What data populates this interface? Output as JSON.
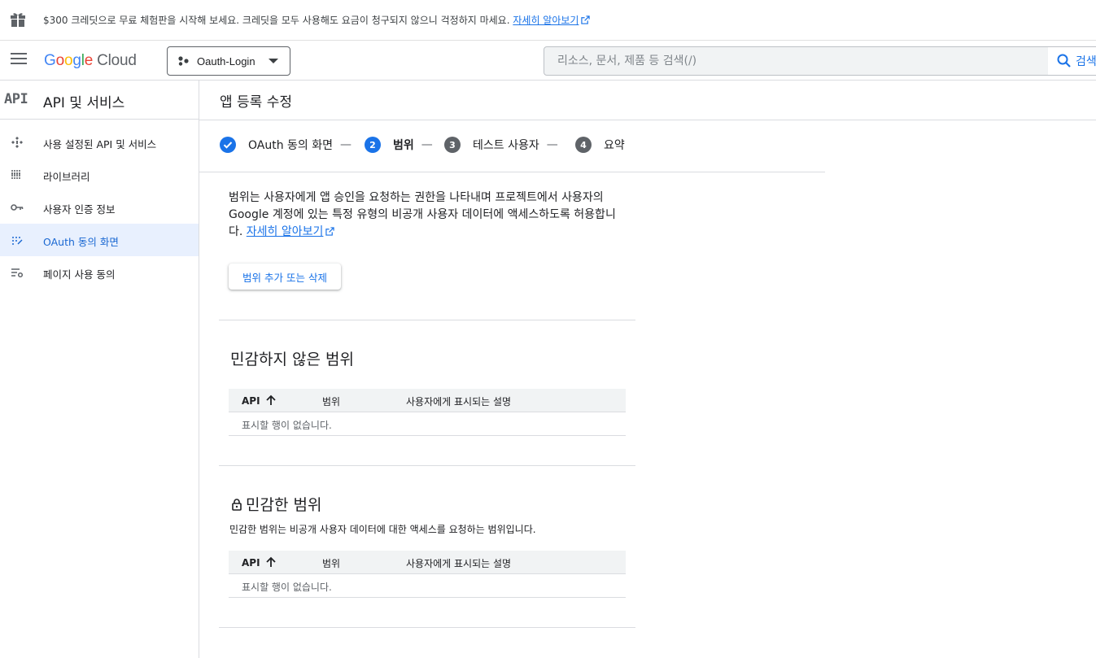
{
  "promo": {
    "text": "$300 크레딧으로 무료 체험판을 시작해 보세요. 크레딧을 모두 사용해도 요금이 청구되지 않으니 걱정하지 마세요.",
    "link": "자세히 알아보기"
  },
  "header": {
    "logo_letters": [
      "G",
      "o",
      "o",
      "g",
      "l",
      "e"
    ],
    "logo_cloud": "Cloud",
    "project_name": "Oauth-Login",
    "search_placeholder": "리소스, 문서, 제품 등 검색(/)",
    "search_button": "검색"
  },
  "sidebar": {
    "logo": "API",
    "title": "API 및 서비스",
    "items": [
      {
        "label": "사용 설정된 API 및 서비스",
        "icon": "api-hub-icon"
      },
      {
        "label": "라이브러리",
        "icon": "library-icon"
      },
      {
        "label": "사용자 인증 정보",
        "icon": "key-icon"
      },
      {
        "label": "OAuth 동의 화면",
        "icon": "consent-icon",
        "active": true
      },
      {
        "label": "페이지 사용 동의",
        "icon": "settings-list-icon"
      }
    ]
  },
  "main": {
    "title": "앱 등록 수정",
    "steps": [
      {
        "number": "✓",
        "label": "OAuth 동의 화면",
        "state": "done"
      },
      {
        "number": "2",
        "label": "범위",
        "state": "current"
      },
      {
        "number": "3",
        "label": "테스트 사용자",
        "state": "pending"
      },
      {
        "number": "4",
        "label": "요약",
        "state": "pending"
      }
    ],
    "step_separator": "—",
    "description": "범위는 사용자에게 앱 승인을 요청하는 권한을 나타내며 프로젝트에서 사용자의 Google 계정에 있는 특정 유형의 비공개 사용자 데이터에 액세스하도록 허용합니다.",
    "description_link": "자세히 알아보기",
    "add_scope_button": "범위 추가 또는 삭제",
    "non_sensitive": {
      "title": "민감하지 않은 범위",
      "columns": [
        "API",
        "범위",
        "사용자에게 표시되는 설명"
      ],
      "empty_text": "표시할 행이 없습니다."
    },
    "sensitive": {
      "title": "민감한 범위",
      "subtitle": "민감한 범위는 비공개 사용자 데이터에 대한 액세스를 요청하는 범위입니다.",
      "columns": [
        "API",
        "범위",
        "사용자에게 표시되는 설명"
      ],
      "empty_text": "표시할 행이 없습니다."
    }
  },
  "colors": {
    "accent": "#1a73e8",
    "active_bg": "#e8f0fe",
    "step_pending": "#5f6368"
  }
}
